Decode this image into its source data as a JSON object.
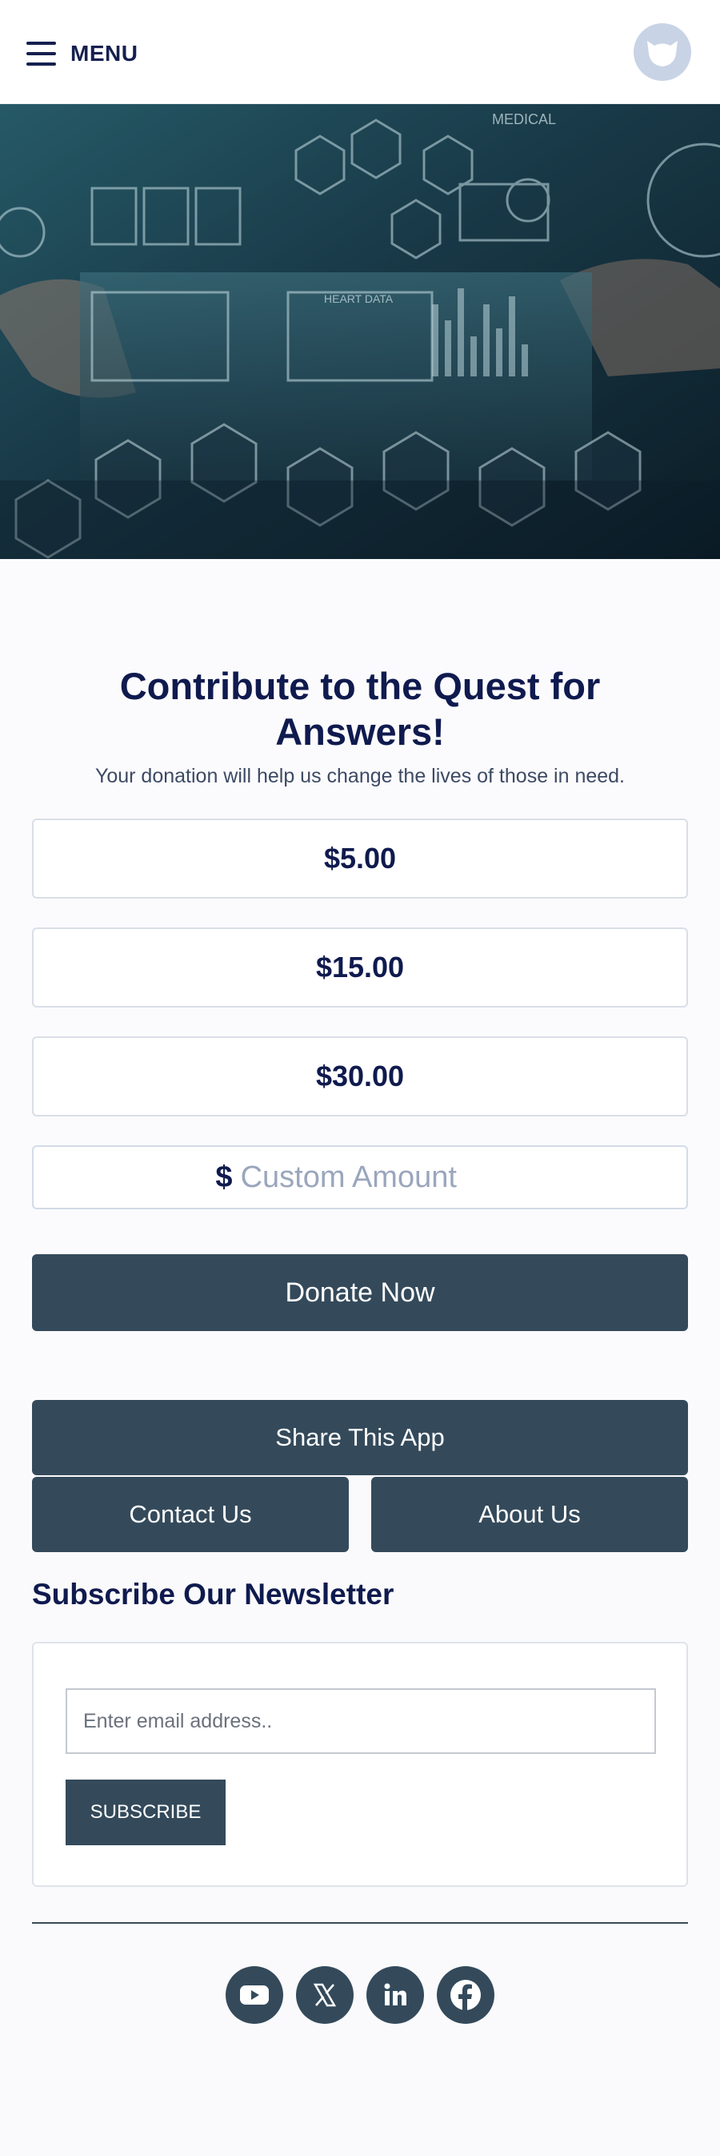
{
  "header": {
    "menu_label": "MENU",
    "menu_icon": "hamburger-icon",
    "logo_icon": "logo-icon"
  },
  "hero": {
    "image": "healthcare-technology-photo",
    "overlay_words": [
      "MEDICAL",
      "HEART DATA"
    ]
  },
  "donation": {
    "title": "Contribute to the Quest for Answers!",
    "subtitle": "Your donation will help us change the lives of those in need.",
    "amounts": [
      "$5.00",
      "$15.00",
      "$30.00"
    ],
    "currency_symbol": "$",
    "custom_placeholder": "Custom Amount",
    "donate_label": "Donate Now"
  },
  "actions": {
    "share_label": "Share This App",
    "contact_label": "Contact Us",
    "about_label": "About Us"
  },
  "newsletter": {
    "title": "Subscribe Our Newsletter",
    "email_placeholder": "Enter email address..",
    "subscribe_label": "SUBSCRIBE"
  },
  "social": {
    "icons": [
      "youtube-icon",
      "x-icon",
      "linkedin-icon",
      "facebook-icon"
    ]
  },
  "colors": {
    "primary_text": "#0f1a4e",
    "button_dark": "#344a5b",
    "border_light": "#d9dee7",
    "page_background": "#fbfbfd"
  }
}
